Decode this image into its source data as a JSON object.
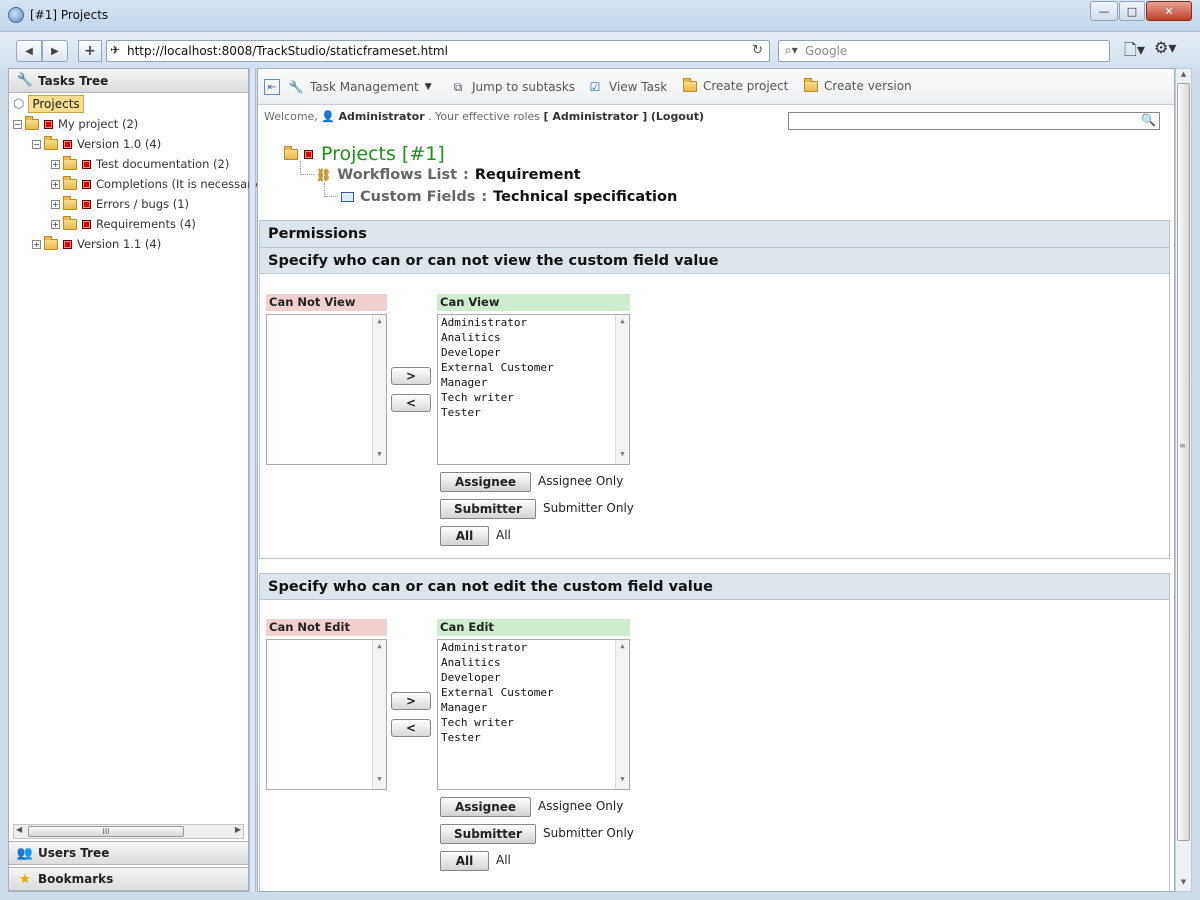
{
  "window": {
    "title": "[#1] Projects",
    "minimize": "—",
    "maximize": "□",
    "close": "✕"
  },
  "browser": {
    "url": "http://localhost:8008/TrackStudio/staticframeset.html",
    "search_placeholder": "Google",
    "back": "◀",
    "forward": "▶",
    "new_tab": "+"
  },
  "left": {
    "tasks_tree_label": "Tasks Tree",
    "projects_tab": "Projects",
    "tree": [
      {
        "label": "My project (2)",
        "level": 0
      },
      {
        "label": "Version 1.0 (4)",
        "level": 1
      },
      {
        "label": "Test documentation (2)",
        "level": 2
      },
      {
        "label": "Completions (It is necessary to",
        "level": 2
      },
      {
        "label": "Errors / bugs (1)",
        "level": 2
      },
      {
        "label": "Requirements (4)",
        "level": 2
      },
      {
        "label": "Version 1.1 (4)",
        "level": 1
      }
    ],
    "scroll_grip": "III",
    "users_tree_label": "Users Tree",
    "bookmarks_label": "Bookmarks"
  },
  "toolbar": {
    "task_management": "Task Management",
    "jump_to_subtasks": "Jump to subtasks",
    "view_task": "View Task",
    "create_project": "Create project",
    "create_version": "Create version"
  },
  "welcome": {
    "prefix": "Welcome,",
    "user": "Administrator",
    "roles_text": ". Your effective roles",
    "roles": "[ Administrator ]",
    "logout": "(Logout)"
  },
  "header": {
    "title": "Projects",
    "id": "[#1]",
    "crumb1_label": "Workflows List",
    "crumb1_value": "Requirement",
    "crumb2_label": "Custom Fields",
    "crumb2_value": "Technical specification",
    "sep": ":"
  },
  "permissions": {
    "title": "Permissions",
    "view": {
      "title": "Specify who can or can not view the custom field value",
      "left_label": "Can Not View",
      "right_label": "Can View",
      "roles": [
        "Administrator",
        "Analitics",
        "Developer",
        "External Customer",
        "Manager",
        "Tech writer",
        "Tester"
      ],
      "move_right": ">",
      "move_left": "<",
      "assignee_btn": "Assignee",
      "assignee_text": "Assignee Only",
      "submitter_btn": "Submitter",
      "submitter_text": "Submitter Only",
      "all_btn": "All",
      "all_text": "All"
    },
    "edit": {
      "title": "Specify who can or can not edit the custom field value",
      "left_label": "Can Not Edit",
      "right_label": "Can Edit",
      "roles": [
        "Administrator",
        "Analitics",
        "Developer",
        "External Customer",
        "Manager",
        "Tech writer",
        "Tester"
      ],
      "move_right": ">",
      "move_left": "<",
      "assignee_btn": "Assignee",
      "assignee_text": "Assignee Only",
      "submitter_btn": "Submitter",
      "submitter_text": "Submitter Only",
      "all_btn": "All",
      "all_text": "All"
    }
  },
  "colors": {
    "projects_title": "#1e8f1e",
    "cannot_bg": "#f1d0d0",
    "can_bg": "#cfeccf"
  }
}
